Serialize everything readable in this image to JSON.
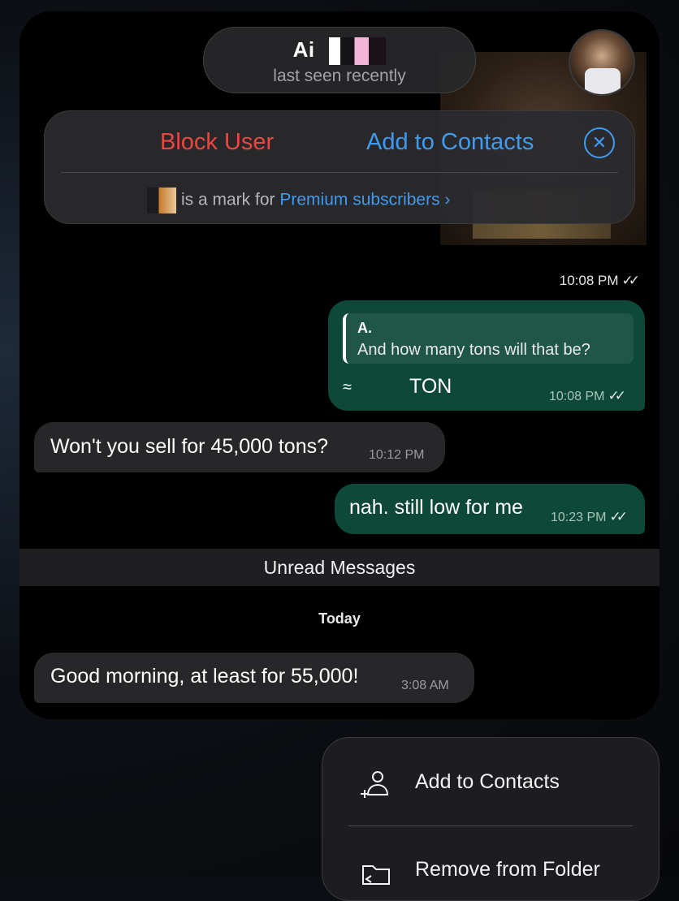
{
  "header": {
    "name": "Ai",
    "status": "last seen recently"
  },
  "action_bar": {
    "block_label": "Block User",
    "add_contacts_label": "Add to Contacts",
    "close_icon": "close-circle-icon",
    "premium_text": "is a mark for",
    "premium_link": "Premium subscribers"
  },
  "messages": {
    "top_time": "10:08 PM",
    "reply": {
      "author": "A.",
      "quoted_text": "And how many tons will that be?",
      "approx_symbol": "≈",
      "amount_text": "TON",
      "time": "10:08 PM"
    },
    "incoming_1": {
      "text": "Won't you sell for 45,000 tons?",
      "time": "10:12 PM"
    },
    "outgoing_2": {
      "text": "nah. still low for me",
      "time": "10:23 PM"
    },
    "unread_label": "Unread Messages",
    "date_label": "Today",
    "incoming_2": {
      "text": "Good morning, at least for 55,000!",
      "time": "3:08 AM"
    }
  },
  "context_menu": {
    "items": [
      {
        "label": "Add to Contacts",
        "icon": "add-contact-icon"
      },
      {
        "label": "Remove from Folder",
        "icon": "folder-remove-icon"
      }
    ]
  },
  "colors": {
    "accent_blue": "#3e9bf0",
    "danger_red": "#e8483f",
    "outgoing_bubble": "#0d4838",
    "incoming_bubble": "#27272a"
  }
}
